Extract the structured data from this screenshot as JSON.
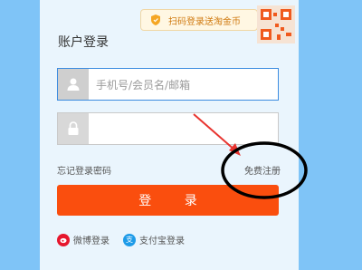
{
  "promo": {
    "text": "扫码登录送淘金币",
    "icon": "shield-icon"
  },
  "qr": {
    "icon": "qr-code-icon"
  },
  "login": {
    "title": "账户登录",
    "username_placeholder": "手机号/会员名/邮箱",
    "username_icon": "user-icon",
    "password_icon": "lock-icon",
    "forgot_label": "忘记登录密码",
    "register_label": "免费注册",
    "submit_label": "登 录"
  },
  "alt_login": [
    {
      "label": "微博登录",
      "icon": "weibo-icon"
    },
    {
      "label": "支付宝登录",
      "icon": "alipay-icon",
      "glyph": "支"
    }
  ],
  "colors": {
    "background": "#7fc4f7",
    "panel": "#eaf5fd",
    "submit": "#fa4e0e",
    "promo_text": "#d07a10",
    "annotation": "#e8342f"
  }
}
